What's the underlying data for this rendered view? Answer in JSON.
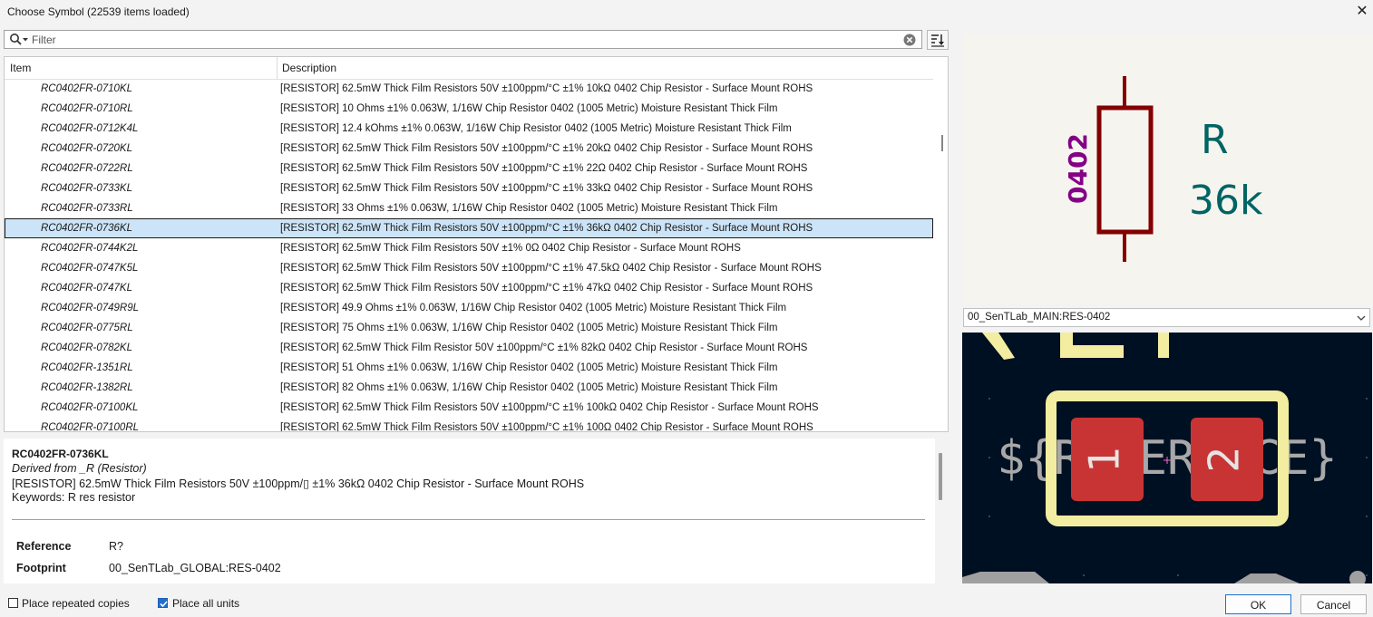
{
  "window": {
    "title": "Choose Symbol (22539 items loaded)",
    "close_glyph": "✕"
  },
  "filter": {
    "placeholder": "Filter",
    "value": "",
    "icons": [
      "search-icon",
      "clear-icon",
      "sort-icon"
    ]
  },
  "list": {
    "columns": [
      "Item",
      "Description"
    ],
    "selected_index": 7,
    "rows": [
      {
        "name": "RC0402FR-0710KL",
        "desc": "[RESISTOR] 62.5mW Thick Film Resistors 50V ±100ppm/°C ±1% 10kΩ 0402 Chip Resistor - Surface Mount ROHS"
      },
      {
        "name": "RC0402FR-0710RL",
        "desc": "[RESISTOR] 10 Ohms ±1% 0.063W, 1/16W Chip Resistor 0402 (1005 Metric) Moisture Resistant Thick Film"
      },
      {
        "name": "RC0402FR-0712K4L",
        "desc": "[RESISTOR] 12.4 kOhms ±1% 0.063W, 1/16W Chip Resistor 0402 (1005 Metric) Moisture Resistant Thick Film"
      },
      {
        "name": "RC0402FR-0720KL",
        "desc": "[RESISTOR] 62.5mW Thick Film Resistors 50V ±100ppm/°C ±1% 20kΩ 0402 Chip Resistor - Surface Mount ROHS"
      },
      {
        "name": "RC0402FR-0722RL",
        "desc": "[RESISTOR] 62.5mW Thick Film Resistors 50V ±100ppm/°C ±1% 22Ω 0402 Chip Resistor - Surface Mount ROHS"
      },
      {
        "name": "RC0402FR-0733KL",
        "desc": "[RESISTOR] 62.5mW Thick Film Resistors 50V ±100ppm/°C ±1% 33kΩ 0402 Chip Resistor - Surface Mount ROHS"
      },
      {
        "name": "RC0402FR-0733RL",
        "desc": "[RESISTOR] 33 Ohms ±1% 0.063W, 1/16W Chip Resistor 0402 (1005 Metric) Moisture Resistant Thick Film"
      },
      {
        "name": "RC0402FR-0736KL",
        "desc": "[RESISTOR] 62.5mW Thick Film Resistors 50V ±100ppm/°C ±1% 36kΩ 0402 Chip Resistor - Surface Mount ROHS"
      },
      {
        "name": "RC0402FR-0744K2L",
        "desc": "[RESISTOR] 62.5mW Thick Film Resistors 50V ±1% 0Ω 0402 Chip Resistor - Surface Mount ROHS"
      },
      {
        "name": "RC0402FR-0747K5L",
        "desc": "[RESISTOR] 62.5mW Thick Film Resistors 50V ±100ppm/°C ±1% 47.5kΩ 0402 Chip Resistor - Surface Mount ROHS"
      },
      {
        "name": "RC0402FR-0747KL",
        "desc": "[RESISTOR] 62.5mW Thick Film Resistors 50V ±100ppm/°C ±1% 47kΩ 0402 Chip Resistor - Surface Mount ROHS"
      },
      {
        "name": "RC0402FR-0749R9L",
        "desc": "[RESISTOR] 49.9 Ohms ±1% 0.063W, 1/16W Chip Resistor 0402 (1005 Metric) Moisture Resistant Thick Film"
      },
      {
        "name": "RC0402FR-0775RL",
        "desc": "[RESISTOR] 75 Ohms ±1% 0.063W, 1/16W Chip Resistor 0402 (1005 Metric) Moisture Resistant Thick Film"
      },
      {
        "name": "RC0402FR-0782KL",
        "desc": "[RESISTOR] 62.5mW Thick Film Resistor 50V ±100ppm/°C ±1% 82kΩ 0402 Chip Resistor - Surface Mount ROHS"
      },
      {
        "name": "RC0402FR-1351RL",
        "desc": "[RESISTOR] 51 Ohms ±1% 0.063W, 1/16W Chip Resistor 0402 (1005 Metric) Moisture Resistant Thick Film"
      },
      {
        "name": "RC0402FR-1382RL",
        "desc": "[RESISTOR] 82 Ohms ±1% 0.063W, 1/16W Chip Resistor 0402 (1005 Metric) Moisture Resistant Thick Film"
      },
      {
        "name": "RC0402FR-07100KL",
        "desc": "[RESISTOR] 62.5mW Thick Film Resistors 50V ±100ppm/°C ±1% 100kΩ 0402 Chip Resistor - Surface Mount ROHS"
      },
      {
        "name": "RC0402FR-07100RL",
        "desc": "[RESISTOR] 62.5mW Thick Film Resistors 50V ±100ppm/°C ±1% 100Ω 0402 Chip Resistor - Surface Mount ROHS"
      }
    ]
  },
  "details": {
    "name": "RC0402FR-0736KL",
    "derived": "Derived from _R (Resistor)",
    "description": "[RESISTOR] 62.5mW Thick Film Resistors 50V ±100ppm/▯ ±1% 36kΩ 0402 Chip Resistor - Surface Mount ROHS",
    "keywords": "Keywords: R res resistor",
    "fields": {
      "reference_label": "Reference",
      "reference_value": "R?",
      "footprint_label": "Footprint",
      "footprint_value": "00_SenTLab_GLOBAL:RES-0402"
    }
  },
  "symbol_preview": {
    "ref_text": "R",
    "value_text": "36k",
    "footprint_text": "0402",
    "colors": {
      "body": "#840000",
      "ref": "#006464",
      "footprint": "#840084",
      "bg": "#f5f4ef"
    }
  },
  "footprint_select": {
    "selected": "00_SenTLab_MAIN:RES-0402"
  },
  "footprint_preview": {
    "pad1": "1",
    "pad2": "2",
    "ref_text": "${REFERENCE}",
    "colors": {
      "bg": "#001023",
      "pad": "#c83434",
      "courtyard": "#f2eda1",
      "text": "#a8a8a8"
    }
  },
  "options": {
    "repeat_label": "Place repeated copies",
    "repeat_checked": false,
    "units_label": "Place all units",
    "units_checked": true
  },
  "buttons": {
    "ok": "OK",
    "cancel": "Cancel"
  }
}
